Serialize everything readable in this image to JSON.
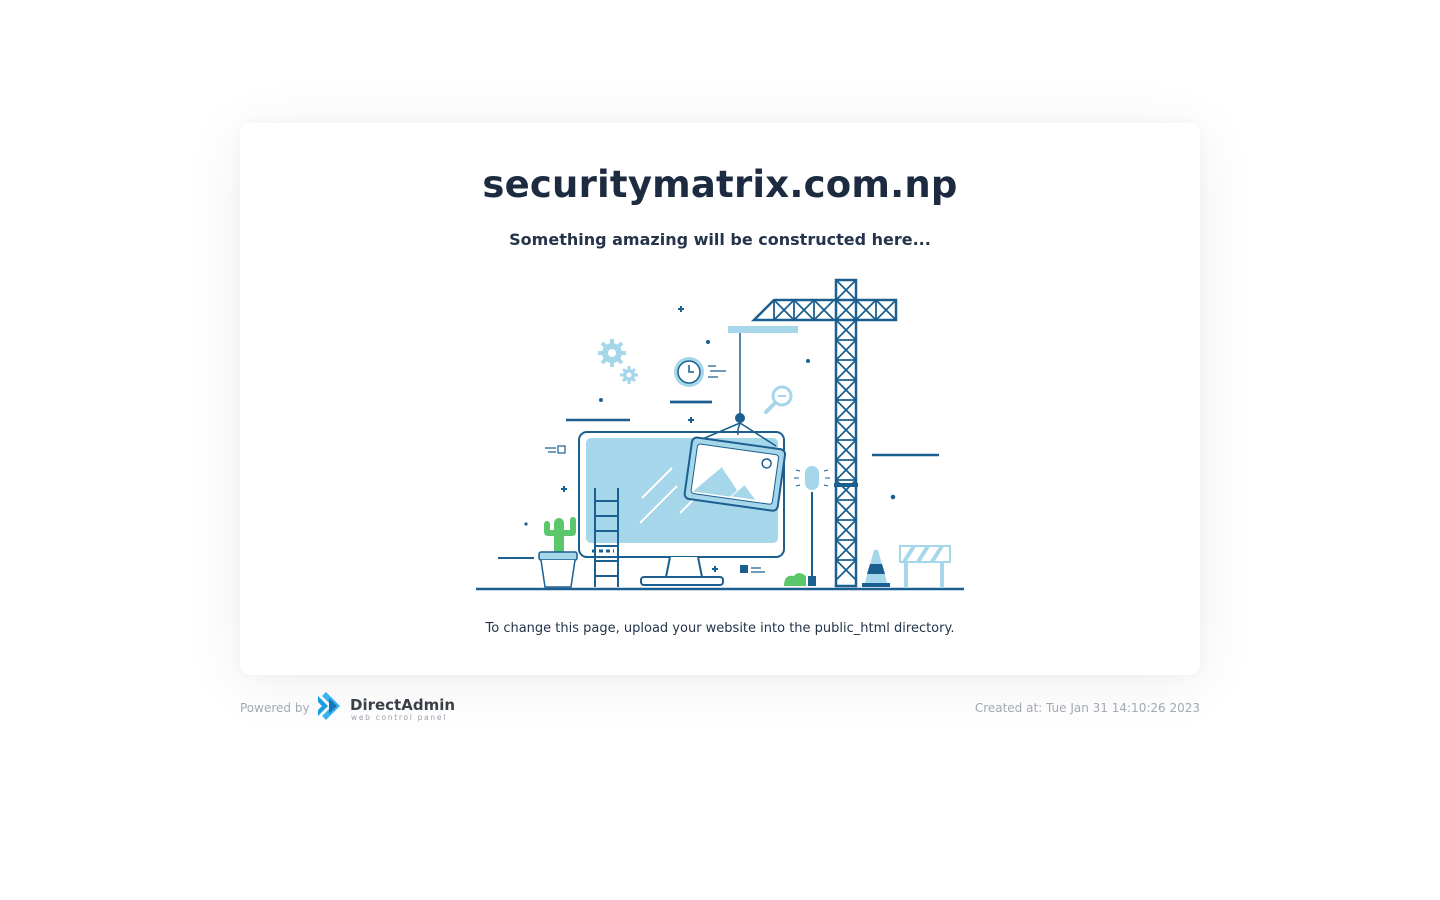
{
  "domain": "securitymatrix.com.np",
  "tagline": "Something amazing will be constructed here...",
  "hint": "To change this page, upload your website into the public_html directory.",
  "footer": {
    "powered_by": "Powered by",
    "brand": "DirectAdmin",
    "brand_sub": "web control panel",
    "created": "Created at: Tue Jan 31 14:10:26 2023"
  },
  "illustration_icon": "under-construction-crane-monitor",
  "colors": {
    "dark_blue": "#1a5f8f",
    "light_blue": "#a6d6ea",
    "green": "#5bc66a",
    "text": "#1c2b40",
    "muted": "#a3a9b2"
  }
}
